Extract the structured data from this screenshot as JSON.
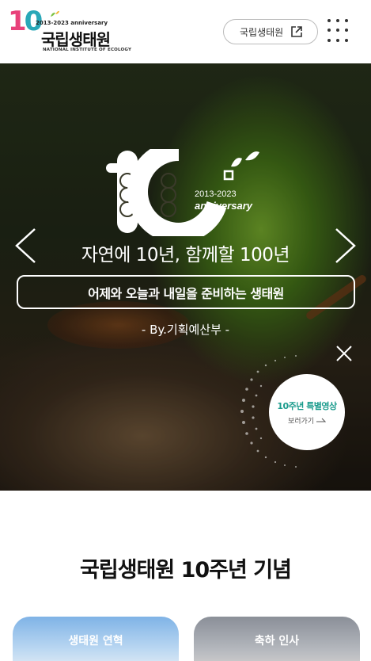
{
  "header": {
    "logo": {
      "ten": "10",
      "years": "2013-2023 anniversary",
      "name_ko": "국립생태원",
      "name_en": "NATIONAL INSTITUTE OF ECOLOGY"
    },
    "site_button_label": "국립생태원"
  },
  "hero": {
    "emblem": {
      "years": "2013-2023",
      "anniversary": "anniversary"
    },
    "title": "자연에 10년, 함께할 100년",
    "box_text": "어제와 오늘과 내일을 준비하는 생태원",
    "by_line": "- By.기획예산부 -",
    "video_badge": {
      "title": "10주년 특별영상",
      "sub": "보러가기"
    }
  },
  "section": {
    "title": "국립생태원 10주년 기념",
    "cards": [
      {
        "label": "생태원 연혁"
      },
      {
        "label": "축하 인사"
      }
    ]
  },
  "colors": {
    "accent_pink": "#e8417a",
    "accent_teal": "#2aa8b8",
    "badge_green": "#1a9b8c"
  }
}
